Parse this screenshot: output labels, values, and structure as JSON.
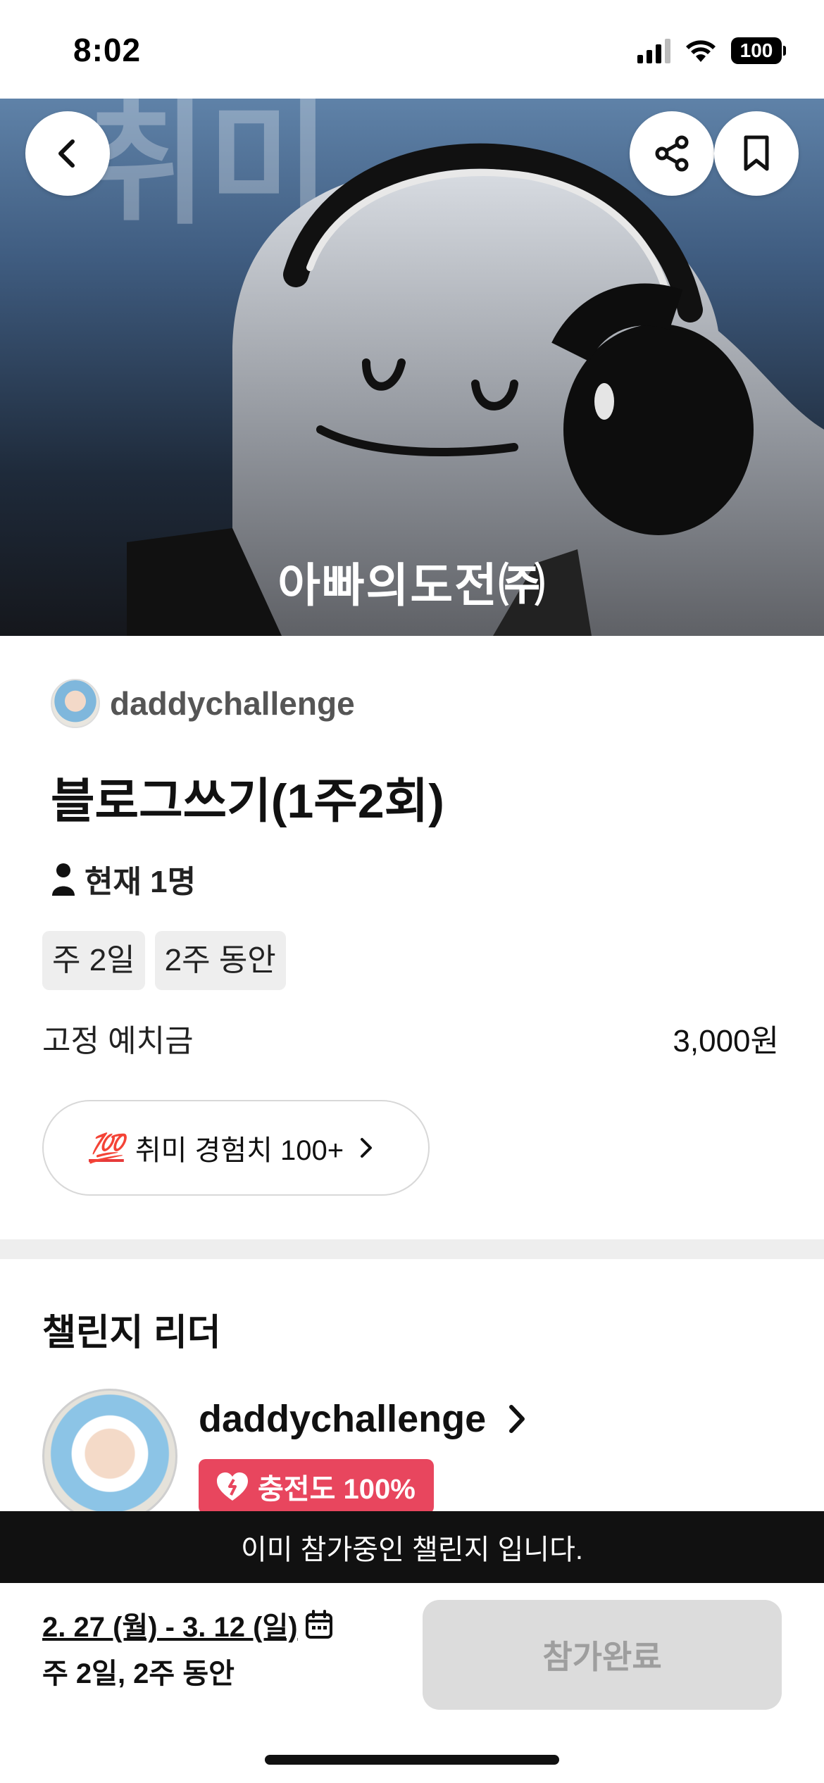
{
  "status_bar": {
    "time": "8:02",
    "battery": "100"
  },
  "hero": {
    "bg_text": "취미",
    "brand_text": "아빠의도전㈜"
  },
  "icons": {
    "back": "chevron-left-icon",
    "share": "share-icon",
    "bookmark": "bookmark-icon",
    "person": "person-icon",
    "calendar": "calendar-icon",
    "heart": "broken-heart-icon"
  },
  "challenge": {
    "author": "daddychallenge",
    "title": "블로그쓰기(1주2회)",
    "members": "현재 1명",
    "tags": [
      "주 2일",
      "2주 동안"
    ],
    "deposit_label": "고정 예치금",
    "deposit_value": "3,000원",
    "xp_emoji": "💯",
    "xp_text": "취미 경험치 100+"
  },
  "leader": {
    "section_title": "챌린지 리더",
    "name": "daddychallenge",
    "badge": "충전도 100%"
  },
  "toast": "이미 참가중인 챌린지 입니다.",
  "bottom": {
    "date_range": "2. 27 (월) - 3. 12 (일)",
    "schedule": "주 2일, 2주 동안",
    "button": "참가완료"
  },
  "colors": {
    "badge": "#e8465e",
    "button_disabled": "#dcdcdc",
    "toast_bg": "#111111"
  }
}
